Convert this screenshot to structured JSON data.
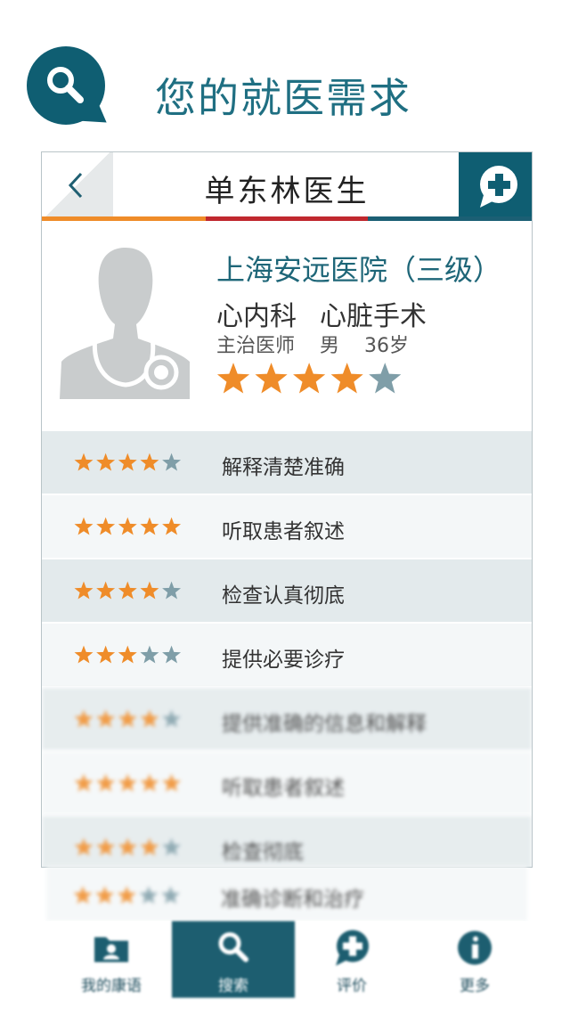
{
  "hero": {
    "title": "您的就医需求",
    "icon": "search-icon"
  },
  "nav": {
    "title": "单东林医生",
    "back_icon": "chevron-left-icon",
    "add_icon": "add-review-icon"
  },
  "colors": {
    "accent": "#0f5e72",
    "orange": "#ef8c29",
    "red": "#c0282e",
    "star_off": "#7f9ea8"
  },
  "doctor": {
    "hospital": "上海安远医院（三级）",
    "department": "心内科",
    "specialty": "心脏手术",
    "title": "主治医师",
    "gender": "男",
    "age": "36岁",
    "rating": 4
  },
  "ratings": [
    {
      "label": "解释清楚准确",
      "stars": 4
    },
    {
      "label": "听取患者叙述",
      "stars": 5
    },
    {
      "label": "检查认真彻底",
      "stars": 4
    },
    {
      "label": "提供必要诊疗",
      "stars": 3
    },
    {
      "label": "提供准确的信息和解释",
      "stars": 4
    },
    {
      "label": "听取患者叙述",
      "stars": 5
    },
    {
      "label": "检查彻底",
      "stars": 4
    },
    {
      "label": "准确诊断和治疗",
      "stars": 3
    }
  ],
  "tabs": [
    {
      "label": "我的康语",
      "icon": "folder-user-icon"
    },
    {
      "label": "搜索",
      "icon": "search-icon"
    },
    {
      "label": "评价",
      "icon": "add-review-icon"
    },
    {
      "label": "更多",
      "icon": "info-icon"
    }
  ]
}
